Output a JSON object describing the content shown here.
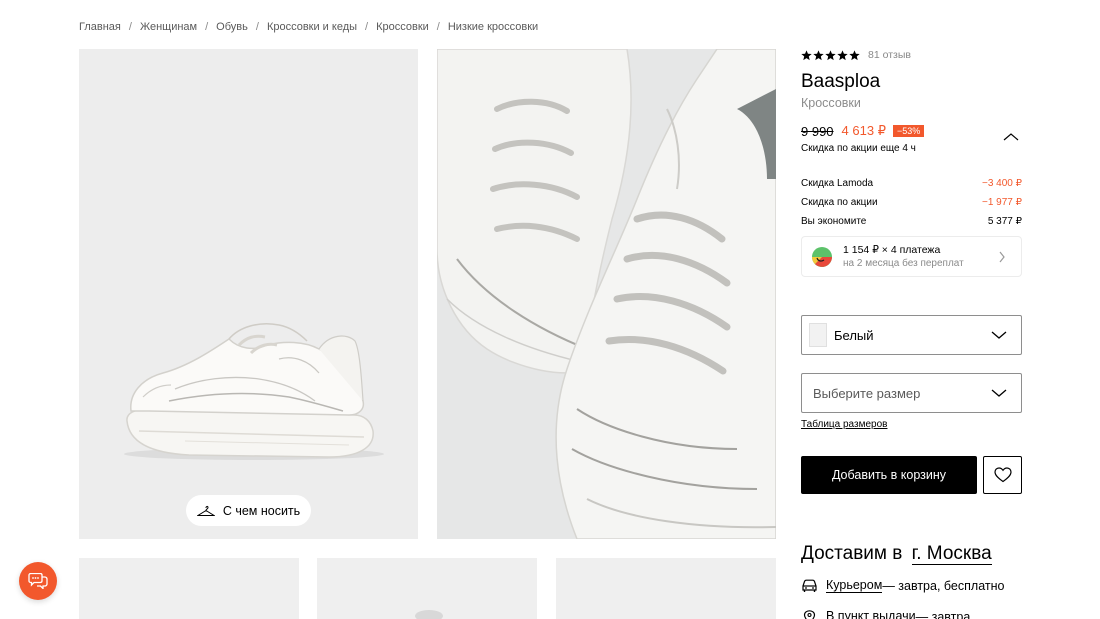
{
  "breadcrumb": [
    "Главная",
    "Женщинам",
    "Обувь",
    "Кроссовки и кеды",
    "Кроссовки",
    "Низкие кроссовки"
  ],
  "breadcrumb_separator": "/",
  "gallery": {
    "wear_button_label": "С чем носить"
  },
  "product": {
    "rating": 5,
    "reviews_label": "81 отзыв",
    "brand": "Baasploa",
    "category": "Кроссовки",
    "old_price": "9 990",
    "new_price": "4 613 ₽",
    "discount_badge": "−53%",
    "promo_time": "Скидка по акции еще 4 ч",
    "breakdown": [
      {
        "label": "Скидка Lamoda",
        "value": "−3 400 ₽",
        "highlight": true
      },
      {
        "label": "Скидка по акции",
        "value": "−1 977 ₽",
        "highlight": true
      },
      {
        "label": "Вы экономите",
        "value": "5 377 ₽",
        "highlight": false
      }
    ],
    "split": {
      "main": "1 154 ₽ × 4 платежа",
      "sub": "на 2 месяца без переплат"
    },
    "color_select": {
      "value": "Белый"
    },
    "size_select": {
      "placeholder": "Выберите размер"
    },
    "size_table_link": "Таблица размеров",
    "add_to_cart": "Добавить в корзину"
  },
  "delivery": {
    "title": "Доставим в",
    "city": "г. Москва",
    "courier_link": "Курьером",
    "courier_text": " — завтра, бесплатно",
    "pickup_link": "В пункт выдачи",
    "pickup_text": " — завтра"
  },
  "colors": {
    "accent": "#f2582c",
    "primary_button": "#000000",
    "muted_text": "#8c8c8c"
  }
}
